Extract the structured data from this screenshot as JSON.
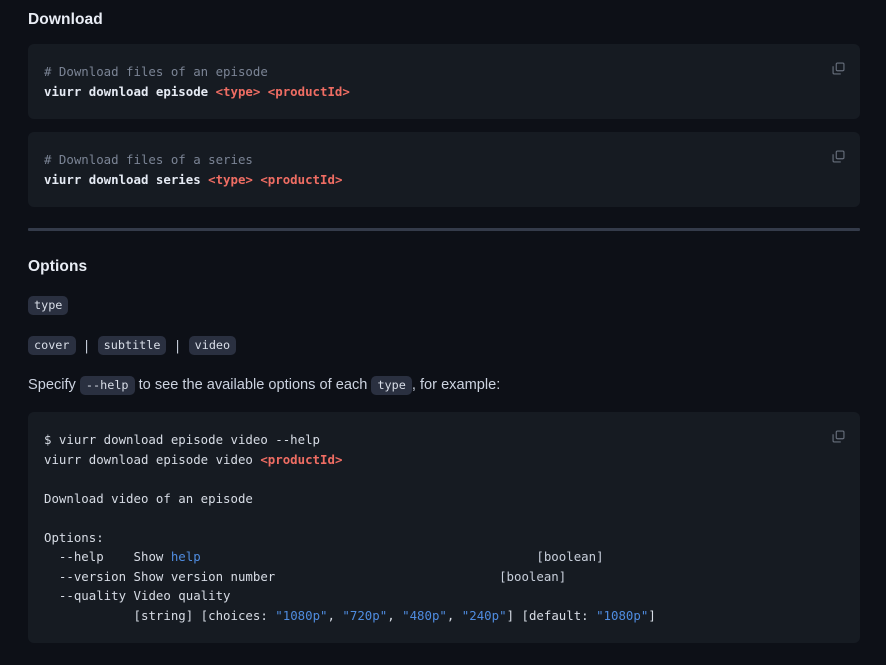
{
  "theme": {
    "page_bg": "#0d1017",
    "code_bg": "#161b22",
    "chip_bg": "#2a3040",
    "divider": "#343b4a",
    "text": "#d7dce5",
    "heading": "#e9edf5",
    "comment": "#7b8495",
    "arg_red": "#ef6d63",
    "string_blue": "#4f8ce0"
  },
  "sections": {
    "download": {
      "heading": "Download",
      "blocks": [
        {
          "copy_icon": "copy-icon",
          "lines": [
            {
              "comment": "# Download files of an episode"
            },
            {
              "cmd": "viurr download episode ",
              "args": "<type> <productId>"
            }
          ]
        },
        {
          "copy_icon": "copy-icon",
          "lines": [
            {
              "comment": "# Download files of a series"
            },
            {
              "cmd": "viurr download series ",
              "args": "<type> <productId>"
            }
          ]
        }
      ]
    },
    "options": {
      "heading": "Options",
      "type_chip": "type",
      "value_chips": [
        "cover",
        "subtitle",
        "video"
      ],
      "separator": "|",
      "paragraph": {
        "part1": "Specify ",
        "chip1": "--help",
        "part2": " to see the available options of each ",
        "chip2": "type",
        "part3": ", for example:"
      },
      "help_block": {
        "copy_icon": "copy-icon",
        "prompt_line": "$ viurr download episode video --help",
        "usage_cmd": "viurr download episode video ",
        "usage_arg": "<productId>",
        "description": "Download video of an episode",
        "options_label": "Options:",
        "rows": [
          {
            "flag": "  --help    ",
            "desc_plain": "Show ",
            "desc_blue": "help",
            "pad": "                                             ",
            "type": "[boolean]"
          },
          {
            "flag": "  --version ",
            "desc_plain": "Show version number",
            "desc_blue": "",
            "pad": "                              ",
            "type": "[boolean]"
          },
          {
            "flag": "  --quality ",
            "desc_plain": "Video quality",
            "desc_blue": "",
            "pad": "",
            "type": ""
          }
        ],
        "quality_detail": {
          "indent": "            ",
          "string_type": "[string] [choices: ",
          "choices": [
            "\"1080p\"",
            "\"720p\"",
            "\"480p\"",
            "\"240p\""
          ],
          "choices_sep": ", ",
          "close_bracket": "] [default: ",
          "default_value": "\"1080p\"",
          "end": "]"
        }
      }
    }
  }
}
